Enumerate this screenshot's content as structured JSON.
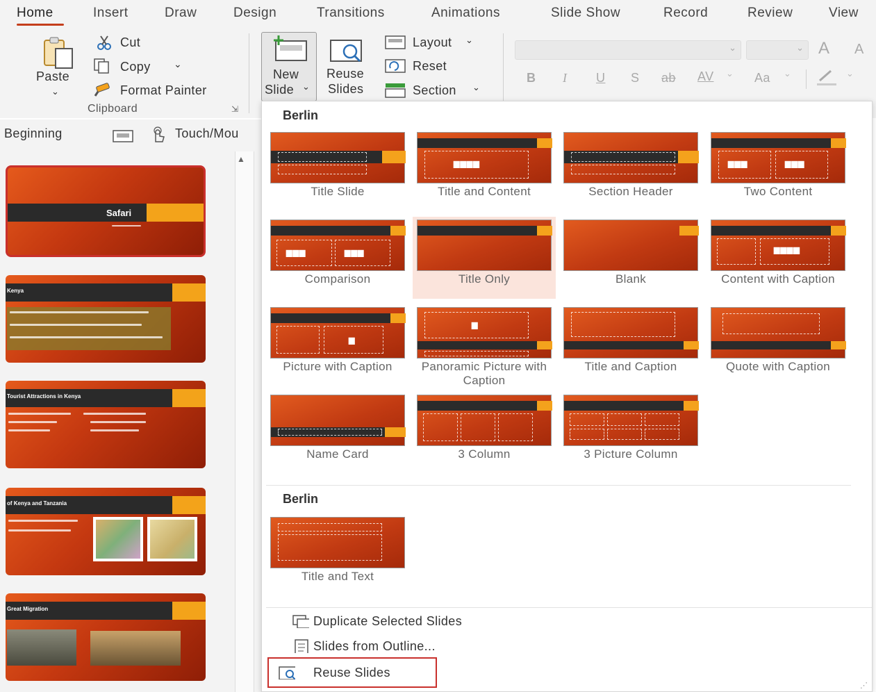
{
  "tabs": [
    "Home",
    "Insert",
    "Draw",
    "Design",
    "Transitions",
    "Animations",
    "Slide Show",
    "Record",
    "Review",
    "View"
  ],
  "clipboard": {
    "paste_label": "Paste",
    "cut_label": "Cut",
    "copy_label": "Copy",
    "format_painter_label": "Format Painter",
    "group_label": "Clipboard"
  },
  "slides_group": {
    "new_slide_line1": "New",
    "new_slide_line2": "Slide",
    "reuse_line1": "Reuse",
    "reuse_line2": "Slides",
    "layout_label": "Layout",
    "reset_label": "Reset",
    "section_label": "Section"
  },
  "font_group": {
    "bold": "B",
    "italic": "I",
    "underline": "U",
    "shadow": "S",
    "strike": "ab",
    "spacing": "AV",
    "case": "Aa",
    "grow": "A",
    "shrink": "A"
  },
  "quick_row": {
    "from_beginning": "Beginning",
    "touch_mouse": "Touch/Mou"
  },
  "thumbnails": [
    {
      "title": "Safari",
      "subtitle": "by Yaw Mensah"
    },
    {
      "title": "Kenya"
    },
    {
      "title": "Tourist Attractions in Kenya"
    },
    {
      "title": "of Kenya and Tanzania"
    },
    {
      "title": "Great Migration"
    }
  ],
  "gallery": {
    "section1_title": "Berlin",
    "section2_title": "Berlin",
    "layouts": [
      "Title Slide",
      "Title and Content",
      "Section Header",
      "Two Content",
      "Comparison",
      "Title Only",
      "Blank",
      "Content with Caption",
      "Picture with Caption",
      "Panoramic Picture with Caption",
      "Title and Caption",
      "Quote with Caption",
      "Name Card",
      "3 Column",
      "3 Picture Column"
    ],
    "extra_layouts": [
      "Title and Text"
    ]
  },
  "menu": {
    "duplicate": "Duplicate Selected Slides",
    "outline": "Slides from Outline...",
    "reuse": "Reuse Slides"
  },
  "colors": {
    "accent": "#c43e1c",
    "theme_orange": "#f4a21c",
    "theme_dark_bar": "#2b2b2b",
    "highlight_box": "#c9302c"
  }
}
